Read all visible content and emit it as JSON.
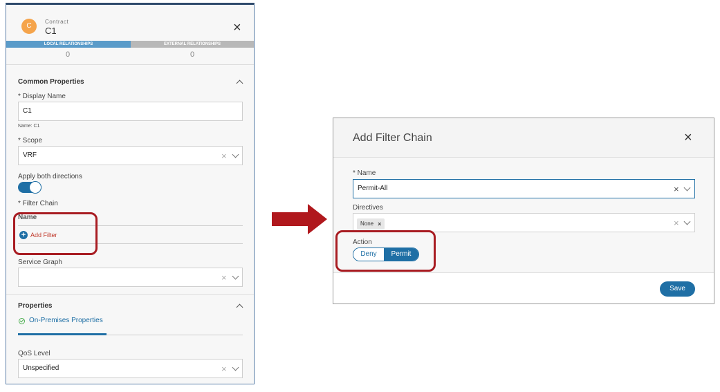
{
  "contract_panel": {
    "avatar_letter": "C",
    "object_type": "Contract",
    "object_name": "C1",
    "close_icon": "close-icon",
    "tabs": [
      {
        "label": "LOCAL RELATIONSHIPS",
        "count": "0"
      },
      {
        "label": "EXTERNAL RELATIONSHIPS",
        "count": "0"
      }
    ],
    "common_properties": {
      "title": "Common Properties",
      "display_name_label": "* Display Name",
      "display_name_value": "C1",
      "name_note": "Name: C1",
      "scope_label": "* Scope",
      "scope_value": "VRF",
      "apply_both_label": "Apply both directions",
      "apply_both_enabled": true,
      "filter_chain_label": "* Filter Chain",
      "filter_name_header": "Name",
      "add_filter_label": "Add Filter",
      "service_graph_label": "Service Graph",
      "service_graph_value": ""
    },
    "properties": {
      "title": "Properties",
      "on_prem_label": "On-Premises Properties",
      "qos_label": "QoS Level",
      "qos_value": "Unspecified"
    }
  },
  "dialog": {
    "title": "Add Filter Chain",
    "name_label": "* Name",
    "name_value": "Permit-All",
    "directives_label": "Directives",
    "directive_tags": [
      "None"
    ],
    "action_label": "Action",
    "action_options": [
      "Deny",
      "Permit"
    ],
    "action_selected": "Permit",
    "save_label": "Save"
  },
  "colors": {
    "accent": "#1f6fa5",
    "highlight_box": "#a81c22",
    "arrow": "#b0181d",
    "avatar": "#f5a44b",
    "add_filter_text": "#c0392b"
  }
}
